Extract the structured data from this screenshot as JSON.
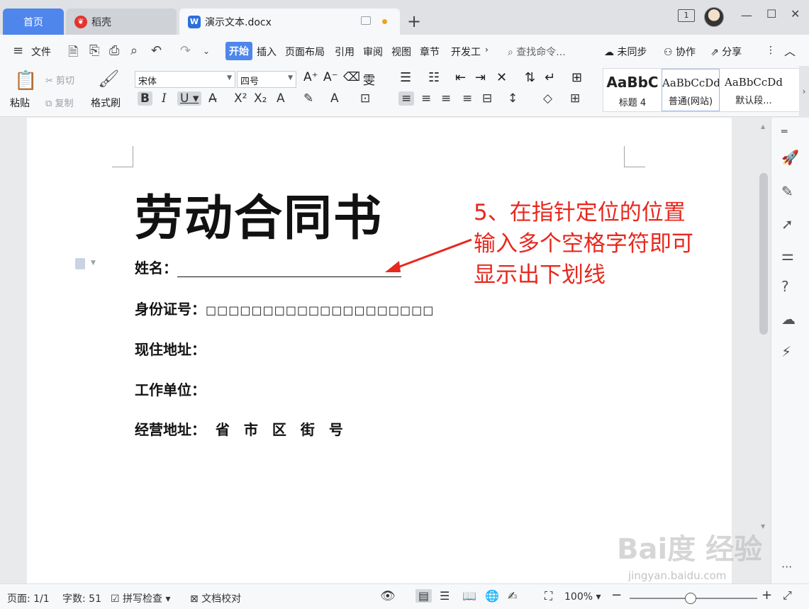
{
  "tabs": {
    "home": "首页",
    "daoke": "稻壳",
    "doc": "演示文本.docx",
    "daoke_icon": "daoke-logo",
    "doc_icon": "W"
  },
  "window": {
    "badge": "1"
  },
  "menu": {
    "file": "文件",
    "items": [
      "开始",
      "插入",
      "页面布局",
      "引用",
      "审阅",
      "视图",
      "章节",
      "开发工"
    ],
    "search_placeholder": "查找命令...",
    "unsynced": "未同步",
    "collab": "协作",
    "share": "分享"
  },
  "ribbon": {
    "paste": "粘贴",
    "cut": "剪切",
    "copy": "复制",
    "format_painter": "格式刷",
    "font": "宋体",
    "size": "四号",
    "styles": [
      {
        "preview": "AaBbC",
        "label": "标题 4"
      },
      {
        "preview": "AaBbCcDd",
        "label": "普通(网站)"
      },
      {
        "preview": "AaBbCcDd",
        "label": "默认段..."
      }
    ]
  },
  "document": {
    "title": "劳动合同书",
    "fields": {
      "name": "姓名：",
      "id": "身份证号：",
      "id_boxes": "□□□□□□□□□□□□□□□□□□□□",
      "address": "现住地址：",
      "work": "工作单位：",
      "biz": "经营地址：",
      "biz_parts": "省　市　区　街　号"
    }
  },
  "annotation": {
    "line1": "5、在指针定位的位置",
    "line2": "输入多个空格字符即可",
    "line3": "显示出下划线",
    "color": "#e8281e"
  },
  "status": {
    "page": "页面: 1/1",
    "words": "字数: 51",
    "spell": "拼写检查",
    "proof": "文档校对",
    "zoom": "100%"
  },
  "watermark": {
    "brand": "Bai度 经验",
    "url": "jingyan.baidu.com"
  },
  "colors": {
    "accent": "#4f86ec",
    "annotation": "#e8281e"
  }
}
